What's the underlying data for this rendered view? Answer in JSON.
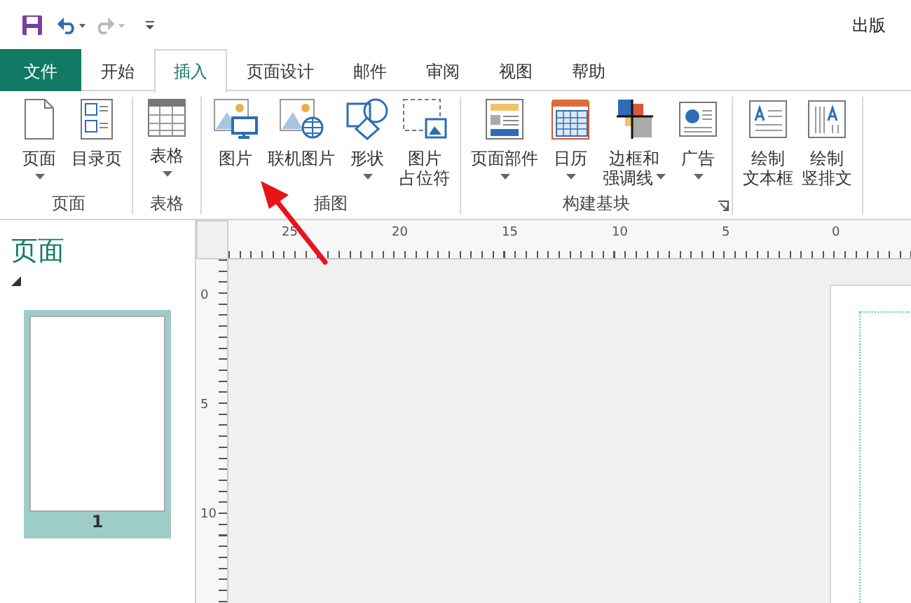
{
  "window": {
    "title": "出版"
  },
  "quick_access": [
    {
      "kind": "save",
      "disabled": false
    },
    {
      "kind": "undo",
      "disabled": false
    },
    {
      "kind": "redo",
      "disabled": true
    },
    {
      "kind": "customize",
      "disabled": false
    }
  ],
  "tabs": [
    {
      "label": "文件",
      "kind": "file",
      "selected": false
    },
    {
      "label": "开始",
      "kind": "tab",
      "selected": false
    },
    {
      "label": "插入",
      "kind": "tab",
      "selected": true
    },
    {
      "label": "页面设计",
      "kind": "tab",
      "selected": false
    },
    {
      "label": "邮件",
      "kind": "tab",
      "selected": false
    },
    {
      "label": "审阅",
      "kind": "tab",
      "selected": false
    },
    {
      "label": "视图",
      "kind": "tab",
      "selected": false
    },
    {
      "label": "帮助",
      "kind": "tab",
      "selected": false
    }
  ],
  "ribbon_groups": [
    {
      "label": "页面",
      "launcher": false,
      "buttons": [
        {
          "kind": "page",
          "lines": [
            "页面"
          ],
          "dropdown": true
        },
        {
          "kind": "toc",
          "lines": [
            "目录页"
          ],
          "dropdown": false
        }
      ]
    },
    {
      "label": "表格",
      "launcher": false,
      "buttons": [
        {
          "kind": "table",
          "lines": [
            "表格"
          ],
          "dropdown": true
        }
      ]
    },
    {
      "label": "插图",
      "launcher": false,
      "buttons": [
        {
          "kind": "picture",
          "lines": [
            "图片"
          ],
          "dropdown": false
        },
        {
          "kind": "online-picture",
          "lines": [
            "联机图片"
          ],
          "dropdown": false
        },
        {
          "kind": "shape",
          "lines": [
            "形状"
          ],
          "dropdown": true
        },
        {
          "kind": "placeholder",
          "lines": [
            "图片",
            "占位符"
          ],
          "dropdown": false
        }
      ]
    },
    {
      "label": "构建基块",
      "launcher": true,
      "buttons": [
        {
          "kind": "page-parts",
          "lines": [
            "页面部件"
          ],
          "dropdown": true
        },
        {
          "kind": "calendar",
          "lines": [
            "日历"
          ],
          "dropdown": true
        },
        {
          "kind": "borders",
          "lines": [
            "边框和",
            "强调线"
          ],
          "dropdown": true
        },
        {
          "kind": "ad",
          "lines": [
            "广告"
          ],
          "dropdown": true
        }
      ]
    },
    {
      "buttons": [
        {
          "kind": "textbox",
          "lines": [
            "绘制",
            "文本框"
          ],
          "dropdown": false
        },
        {
          "kind": "vtextbox",
          "lines": [
            "绘制",
            "竖排文"
          ],
          "dropdown": false
        }
      ]
    }
  ],
  "pages_pane": {
    "title": "页面",
    "pages": [
      {
        "number": "1",
        "selected": true
      }
    ]
  },
  "rulers": {
    "horizontal": [
      "25",
      "20",
      "15",
      "10",
      "5",
      "0"
    ],
    "vertical": [
      "0",
      "5",
      "10"
    ]
  }
}
